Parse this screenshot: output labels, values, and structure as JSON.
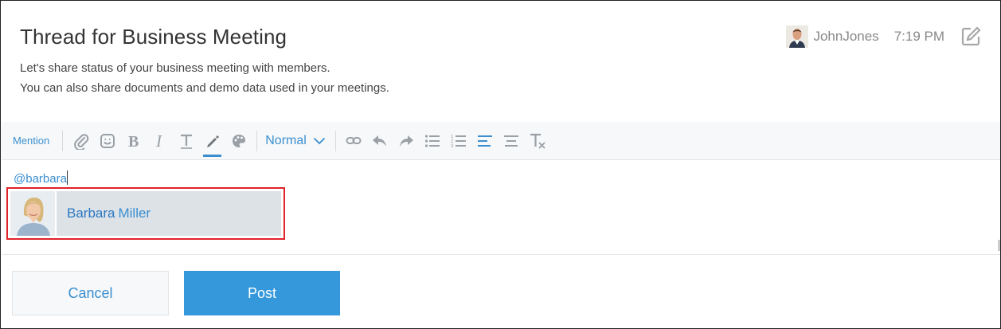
{
  "thread": {
    "title": "Thread for Business Meeting",
    "description_line1": "Let's share status of your business meeting with members.",
    "description_line2": "You can also share documents and demo data used in your meetings."
  },
  "author": {
    "name": "JohnJones",
    "time": "7:19 PM"
  },
  "toolbar": {
    "mention_label": "Mention",
    "format_label": "Normal",
    "tools": [
      "paperclip-icon",
      "emoji-icon",
      "bold-icon",
      "italic-icon",
      "text-size-icon",
      "pen-icon",
      "palette-icon",
      "link-icon",
      "undo-icon",
      "redo-icon",
      "bullet-list-icon",
      "numbered-list-icon",
      "align-left-icon",
      "align-center-icon",
      "clear-format-icon"
    ],
    "accent_color": "#3b8fd0"
  },
  "editor": {
    "text": "@barbara"
  },
  "suggestion": {
    "first_name": "Barbara",
    "last_name": "Miller"
  },
  "buttons": {
    "cancel_label": "Cancel",
    "post_label": "Post",
    "post_color": "#3498db"
  },
  "highlight_color": "#e0222a"
}
